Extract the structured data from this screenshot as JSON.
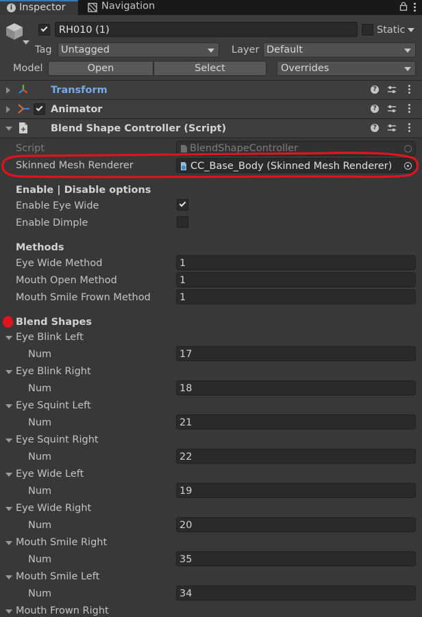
{
  "tabs": {
    "inspector": "Inspector",
    "navigation": "Navigation"
  },
  "header": {
    "object_name": "RH010 (1)",
    "static_label": "Static",
    "tag_label": "Tag",
    "tag_value": "Untagged",
    "layer_label": "Layer",
    "layer_value": "Default",
    "model_label": "Model",
    "open_button": "Open",
    "select_button": "Select",
    "overrides": "Overrides"
  },
  "components": {
    "transform": "Transform",
    "animator": "Animator",
    "blend_controller": "Blend Shape Controller (Script)"
  },
  "script_row": {
    "label": "Script",
    "value": "BlendShapeController"
  },
  "mesh_row": {
    "label": "Skinned Mesh Renderer",
    "value": "CC_Base_Body (Skinned Mesh Renderer)"
  },
  "options": {
    "heading": "Enable | Disable options",
    "eye_wide": "Enable Eye Wide",
    "eye_wide_checked": true,
    "dimple": "Enable Dimple",
    "dimple_checked": false
  },
  "methods": {
    "heading": "Methods",
    "rows": [
      {
        "label": "Eye Wide Method",
        "value": "1"
      },
      {
        "label": "Mouth Open Method",
        "value": "1"
      },
      {
        "label": "Mouth Smile Frown Method",
        "value": "1"
      }
    ]
  },
  "blend_shapes": {
    "heading": "Blend Shapes",
    "num_label": "Num",
    "items": [
      {
        "name": "Eye Blink Left",
        "num": "17"
      },
      {
        "name": "Eye Blink Right",
        "num": "18"
      },
      {
        "name": "Eye Squint Left",
        "num": "21"
      },
      {
        "name": "Eye Squint Right",
        "num": "22"
      },
      {
        "name": "Eye Wide Left",
        "num": "19"
      },
      {
        "name": "Eye Wide Right",
        "num": "20"
      },
      {
        "name": "Mouth Smile Right",
        "num": "35"
      },
      {
        "name": "Mouth Smile Left",
        "num": "34"
      },
      {
        "name": "Mouth Frown Right",
        "num": ""
      }
    ]
  },
  "colors": {
    "annotation_red": "#e0141c",
    "tab_accent": "#3a79bb",
    "transform_title": "#7aa9e6"
  }
}
